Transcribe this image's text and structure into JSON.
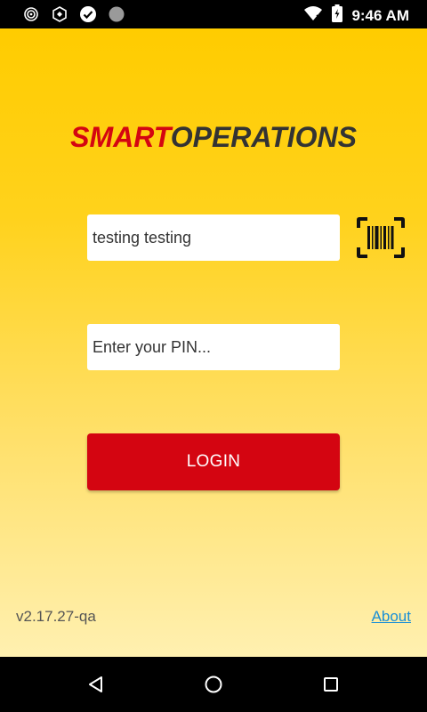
{
  "status_bar": {
    "time": "9:46 AM",
    "notification_icons": [
      "target-icon",
      "shield-icon",
      "check-circle-icon",
      "circle-icon"
    ],
    "system_icons": [
      "wifi-icon",
      "battery-charging-icon"
    ]
  },
  "brand": {
    "part1": "SMART",
    "part2": "OPERATIONS",
    "part1_color": "#d40511",
    "part2_color": "#333333"
  },
  "login_form": {
    "username_value": "testing testing",
    "pin_placeholder": "Enter your PIN...",
    "login_label": "LOGIN",
    "scan_icon": "barcode-scanner-icon"
  },
  "footer": {
    "version": "v2.17.27-qa",
    "about_label": "About"
  },
  "nav_bar": {
    "buttons": [
      "back-icon",
      "home-icon",
      "recents-icon"
    ]
  },
  "colors": {
    "accent": "#d40511",
    "background_top": "#ffcc00",
    "link": "#1a8fd6"
  }
}
